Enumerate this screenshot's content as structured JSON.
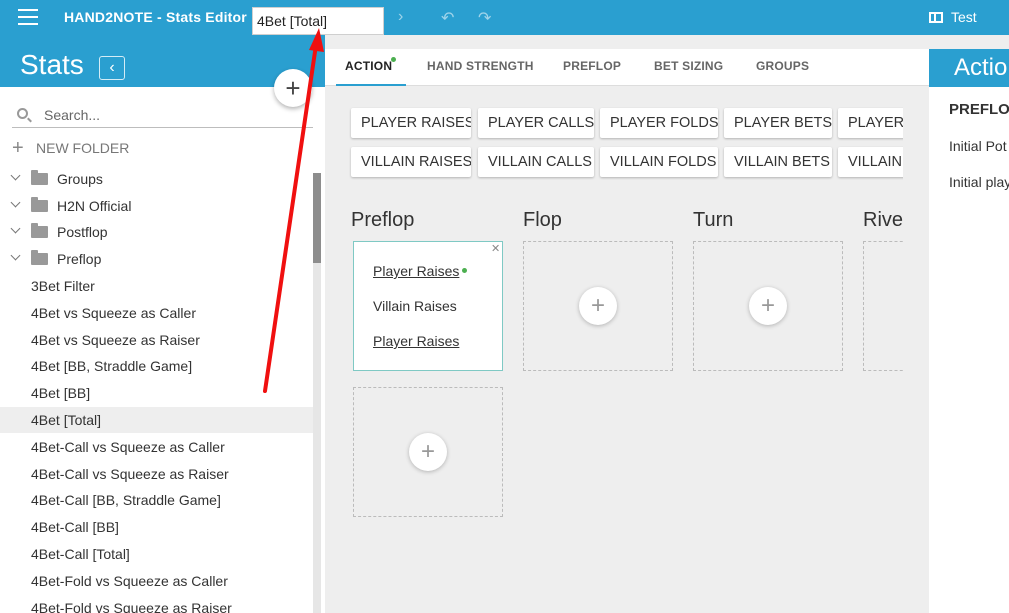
{
  "topbar": {
    "app_title": "HAND2NOTE - Stats Editor",
    "stat_name_value": "4Bet [Total]",
    "user": "Test"
  },
  "sidebar": {
    "title": "Stats",
    "search_placeholder": "Search...",
    "new_folder_label": "NEW FOLDER",
    "folders": [
      {
        "label": "Groups"
      },
      {
        "label": "H2N Official"
      },
      {
        "label": "Postflop"
      },
      {
        "label": "Preflop"
      }
    ],
    "stats": [
      {
        "label": "3Bet Filter"
      },
      {
        "label": "4Bet vs Squeeze as Caller"
      },
      {
        "label": "4Bet vs Squeeze as Raiser"
      },
      {
        "label": "4Bet [BB, Straddle Game]"
      },
      {
        "label": "4Bet [BB]"
      },
      {
        "label": "4Bet [Total]"
      },
      {
        "label": "4Bet-Call vs Squeeze as Caller"
      },
      {
        "label": "4Bet-Call vs Squeeze as Raiser"
      },
      {
        "label": "4Bet-Call [BB, Straddle Game]"
      },
      {
        "label": "4Bet-Call [BB]"
      },
      {
        "label": "4Bet-Call [Total]"
      },
      {
        "label": "4Bet-Fold vs Squeeze as Caller"
      },
      {
        "label": "4Bet-Fold vs Squeeze as Raiser"
      }
    ],
    "selected_stat": "4Bet [Total]"
  },
  "tabs": [
    {
      "label": "ACTION"
    },
    {
      "label": "HAND STRENGTH"
    },
    {
      "label": "PREFLOP"
    },
    {
      "label": "BET SIZING"
    },
    {
      "label": "GROUPS"
    }
  ],
  "active_tab": "ACTION",
  "action_chips": {
    "row1": [
      "PLAYER RAISES",
      "PLAYER CALLS",
      "PLAYER FOLDS",
      "PLAYER BETS",
      "PLAYER C"
    ],
    "row2": [
      "VILLAIN RAISES",
      "VILLAIN CALLS",
      "VILLAIN FOLDS",
      "VILLAIN BETS",
      "VILLAIN C"
    ]
  },
  "streets": [
    {
      "label": "Preflop"
    },
    {
      "label": "Flop"
    },
    {
      "label": "Turn"
    },
    {
      "label": "River"
    }
  ],
  "preflop_conditions": [
    {
      "label": "Player Raises"
    },
    {
      "label": "Villain Raises"
    },
    {
      "label": "Player Raises"
    }
  ],
  "right_panel": {
    "title": "Actio",
    "heading": "PREFLO",
    "line1": "Initial Pot",
    "line2": "Initial play"
  },
  "colors": {
    "accent": "#2a9fd0",
    "status_dot": "#4caf50",
    "annotation_arrow": "#f01010"
  },
  "icons": {
    "menu": "menu-icon",
    "back": "chevron-left-icon",
    "add": "plus-icon",
    "search": "search-icon",
    "folder": "folder-icon",
    "expand": "chevron-down-icon",
    "undo": "undo-icon",
    "redo": "redo-icon",
    "user": "user-card-icon",
    "close": "close-icon"
  }
}
